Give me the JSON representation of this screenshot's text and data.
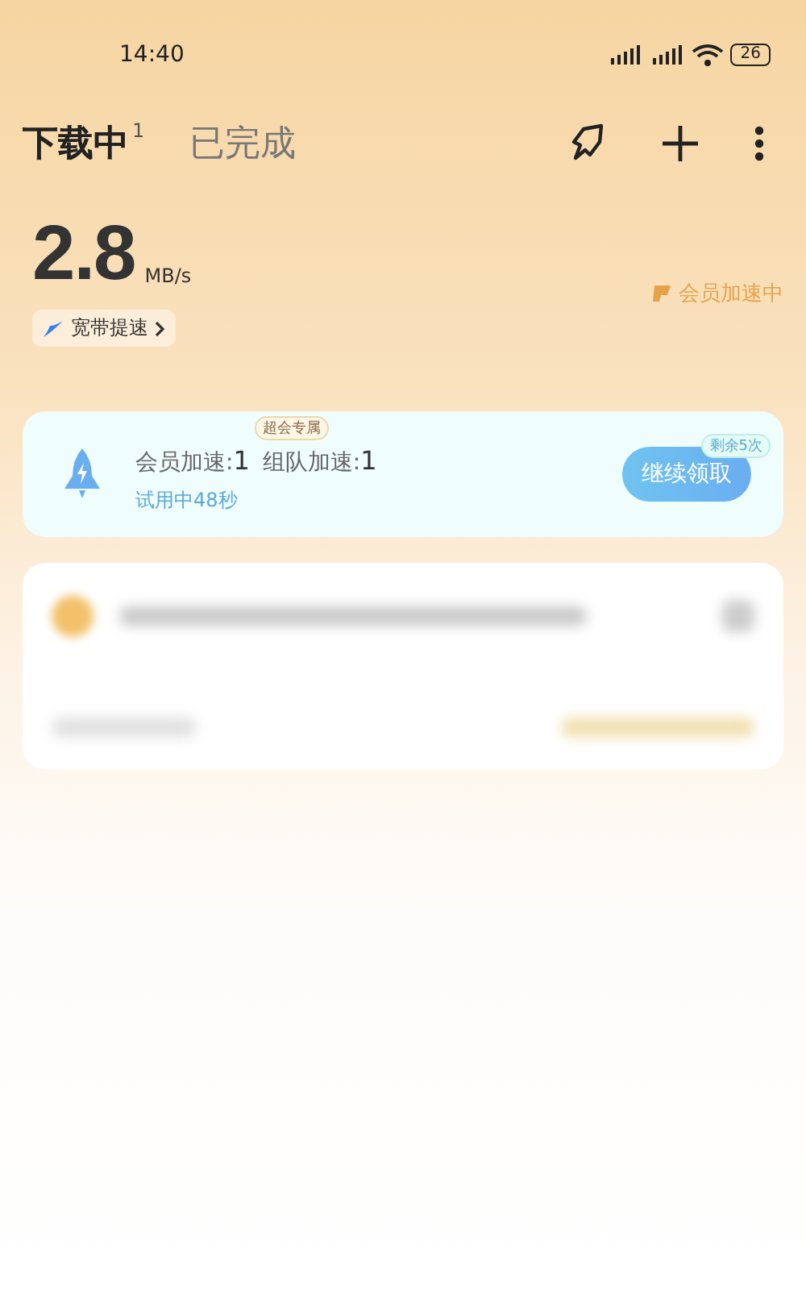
{
  "status_bar": {
    "time": "14:40",
    "battery": "26"
  },
  "tabs": [
    {
      "label": "下载中",
      "badge": "1",
      "selected": true
    },
    {
      "label": "已完成",
      "selected": false
    }
  ],
  "speed": {
    "value": "2.8",
    "unit": "MB/s",
    "boost_link": "宽带提速",
    "vip_status": "会员加速中"
  },
  "accel_card": {
    "tag": "超会专属",
    "member_label": "会员加速:",
    "member_value": "1",
    "team_label": "组队加速:",
    "team_value": "1",
    "trial": "试用中48秒",
    "button": "继续领取",
    "remaining": "剩余5次"
  },
  "task_card": {
    "kind": "blurred"
  }
}
